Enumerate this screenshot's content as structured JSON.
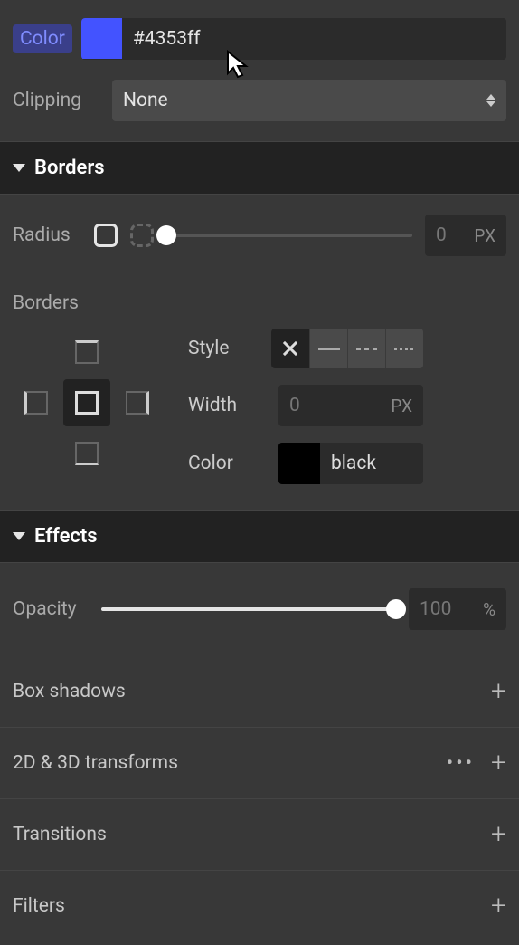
{
  "background": {
    "color_label": "Color",
    "color_value": "#4353ff",
    "clipping_label": "Clipping",
    "clipping_value": "None"
  },
  "borders": {
    "title": "Borders",
    "radius_label": "Radius",
    "radius_value": "0",
    "radius_unit": "PX",
    "sub_label": "Borders",
    "style_label": "Style",
    "width_label": "Width",
    "width_value": "0",
    "width_unit": "PX",
    "color_label": "Color",
    "color_value": "black",
    "color_swatch": "#000000"
  },
  "effects": {
    "title": "Effects",
    "opacity_label": "Opacity",
    "opacity_value": "100",
    "opacity_unit": "%",
    "box_shadows_label": "Box shadows",
    "transforms_label": "2D & 3D transforms",
    "transitions_label": "Transitions",
    "filters_label": "Filters"
  }
}
